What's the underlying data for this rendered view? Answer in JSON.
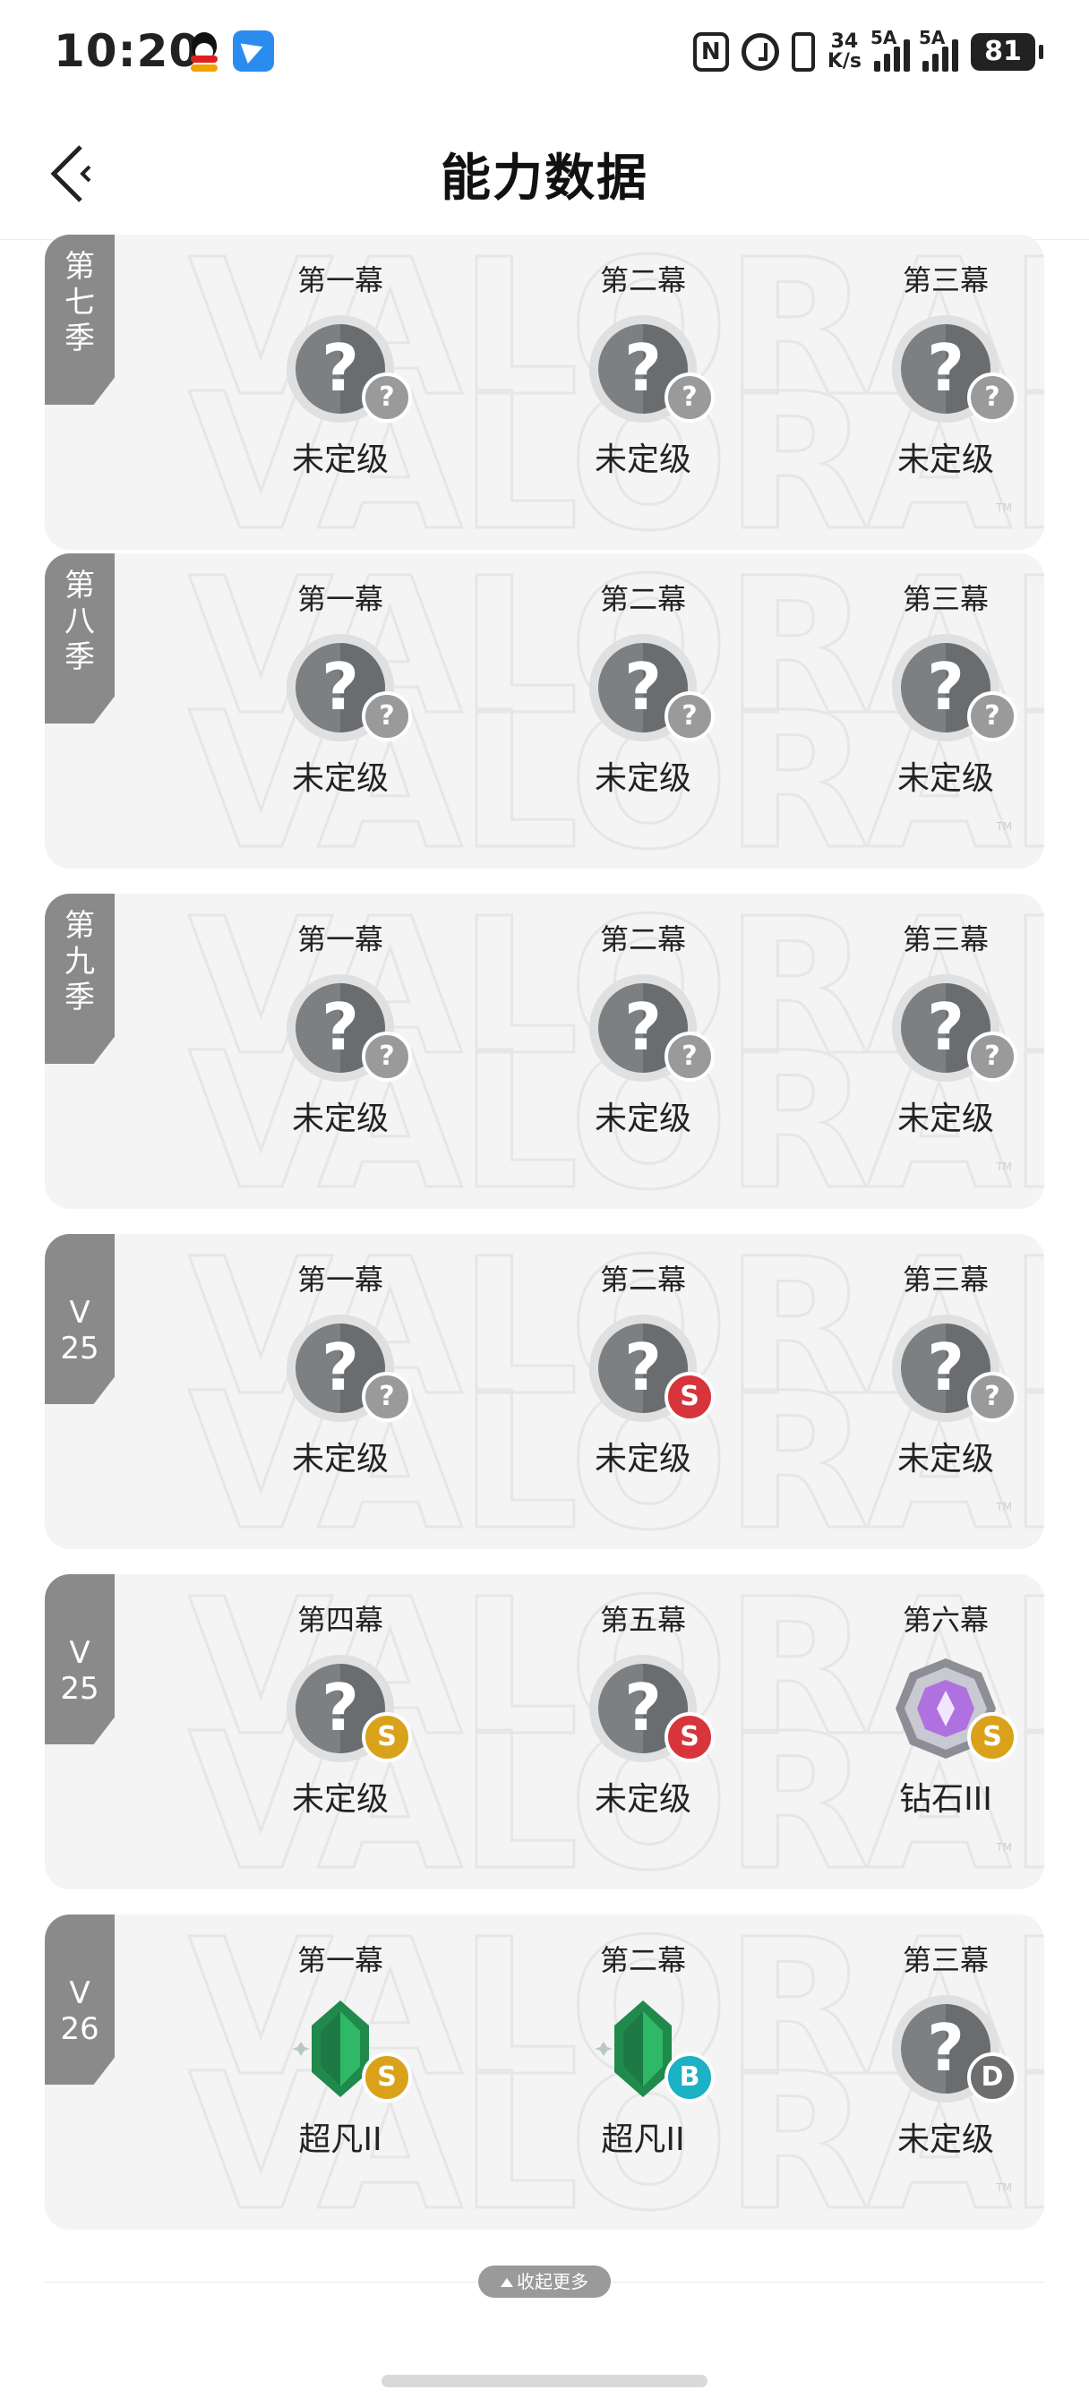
{
  "status_bar": {
    "time": "10:20",
    "icons": [
      "qq-icon",
      "blue-app-icon",
      "nfc-icon",
      "alarm-icon",
      "vibrate-icon"
    ],
    "net_speed_top": "34",
    "net_speed_bottom": "K/s",
    "signal1_label": "5A",
    "signal2_label": "5A",
    "battery": "81"
  },
  "header": {
    "title": "能力数据",
    "back_icon": "back-arrow-icon"
  },
  "seasons": [
    {
      "tag": [
        "第",
        "七",
        "季"
      ],
      "acts": [
        {
          "act": "第一幕",
          "rank": "未定级",
          "emblem": "unranked",
          "badge": "?"
        },
        {
          "act": "第二幕",
          "rank": "未定级",
          "emblem": "unranked",
          "badge": "?"
        },
        {
          "act": "第三幕",
          "rank": "未定级",
          "emblem": "unranked",
          "badge": "?"
        }
      ]
    },
    {
      "tag": [
        "第",
        "八",
        "季"
      ],
      "acts": [
        {
          "act": "第一幕",
          "rank": "未定级",
          "emblem": "unranked",
          "badge": "?"
        },
        {
          "act": "第二幕",
          "rank": "未定级",
          "emblem": "unranked",
          "badge": "?"
        },
        {
          "act": "第三幕",
          "rank": "未定级",
          "emblem": "unranked",
          "badge": "?"
        }
      ]
    },
    {
      "tag": [
        "第",
        "九",
        "季"
      ],
      "acts": [
        {
          "act": "第一幕",
          "rank": "未定级",
          "emblem": "unranked",
          "badge": "?"
        },
        {
          "act": "第二幕",
          "rank": "未定级",
          "emblem": "unranked",
          "badge": "?"
        },
        {
          "act": "第三幕",
          "rank": "未定级",
          "emblem": "unranked",
          "badge": "?"
        }
      ]
    },
    {
      "tag": [
        "V",
        "25"
      ],
      "acts": [
        {
          "act": "第一幕",
          "rank": "未定级",
          "emblem": "unranked",
          "badge": "?"
        },
        {
          "act": "第二幕",
          "rank": "未定级",
          "emblem": "unranked",
          "badge": "S"
        },
        {
          "act": "第三幕",
          "rank": "未定级",
          "emblem": "unranked",
          "badge": "?"
        }
      ]
    },
    {
      "tag": [
        "V",
        "25"
      ],
      "acts": [
        {
          "act": "第四幕",
          "rank": "未定级",
          "emblem": "unranked",
          "badge": "S"
        },
        {
          "act": "第五幕",
          "rank": "未定级",
          "emblem": "unranked",
          "badge": "S"
        },
        {
          "act": "第六幕",
          "rank": "钻石III",
          "emblem": "diamond",
          "badge": "S"
        }
      ]
    },
    {
      "tag": [
        "V",
        "26"
      ],
      "acts": [
        {
          "act": "第一幕",
          "rank": "超凡II",
          "emblem": "ascendant",
          "badge": "S"
        },
        {
          "act": "第二幕",
          "rank": "超凡II",
          "emblem": "ascendant",
          "badge": "B"
        },
        {
          "act": "第三幕",
          "rank": "未定级",
          "emblem": "unranked",
          "badge": "D"
        }
      ]
    }
  ],
  "collapse_label": "收起更多"
}
